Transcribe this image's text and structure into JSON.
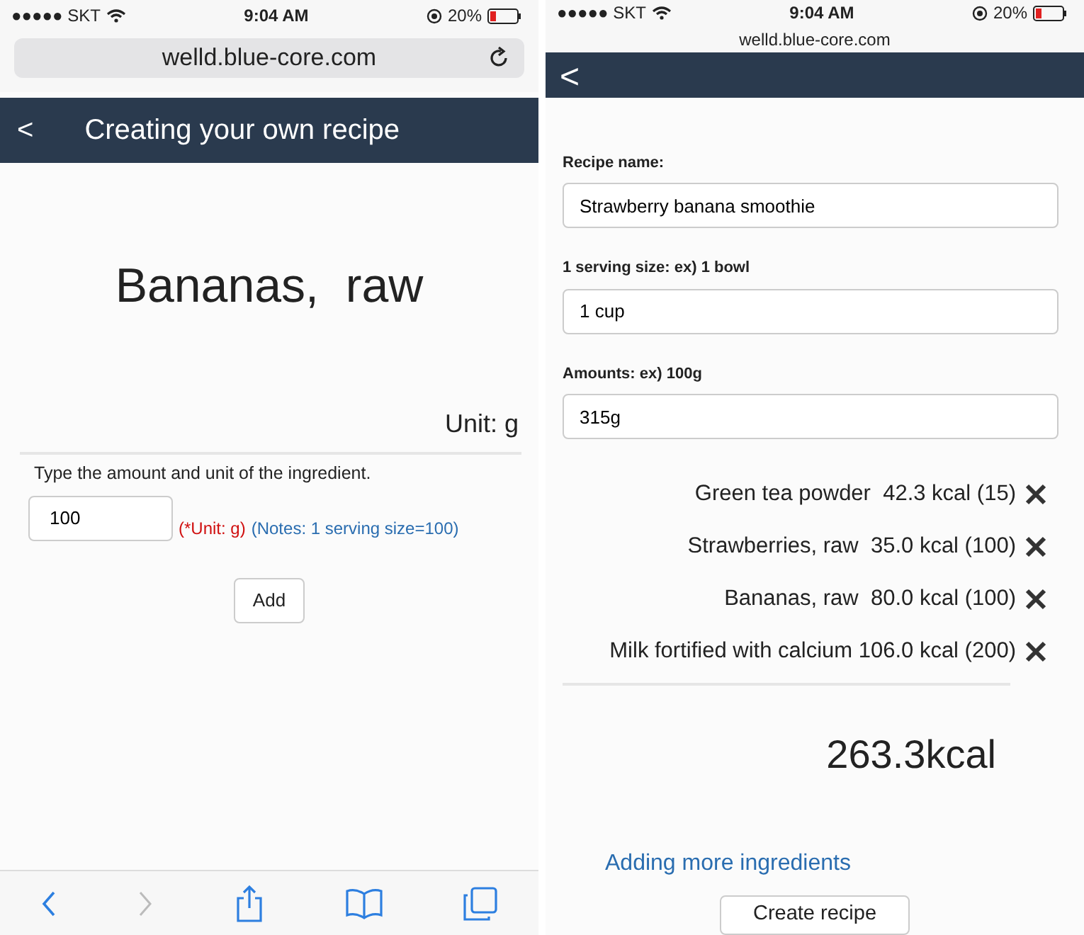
{
  "screens": [
    {
      "status_bar": {
        "carrier": "●●●●● SKT",
        "time": "9:04 AM",
        "battery": "20%"
      },
      "url_bar": {
        "url": "welld.blue-core.com",
        "kind": "full"
      },
      "header": {
        "back": "<",
        "title": "Creating your own recipe"
      },
      "food_title": "Bananas,  raw",
      "unit": "Unit: g",
      "instruction": "Type the amount and unit of the ingredient.",
      "amount_field": {
        "value": "100"
      },
      "unit_note": "(*Unit: g)",
      "serving_note": "(Notes: 1 serving size=100)",
      "add_button": "Add",
      "toolbar": [
        {
          "kind": "back",
          "disabled": false
        },
        {
          "kind": "forward",
          "disabled": true
        },
        {
          "kind": "share",
          "disabled": false
        },
        {
          "kind": "bookmarks",
          "disabled": false
        },
        {
          "kind": "tabs",
          "disabled": false
        }
      ]
    },
    {
      "status_bar": {
        "carrier": "●●●●● SKT",
        "time": "9:04 AM",
        "battery": "20%"
      },
      "url_bar": {
        "url": "welld.blue-core.com",
        "kind": "compact"
      },
      "header": {
        "back": "<"
      },
      "fields": [
        {
          "label": "Recipe name:",
          "value": "Strawberry banana smoothie"
        },
        {
          "label": "1 serving size: ex) 1 bowl",
          "value": "1 cup"
        },
        {
          "label": "Amounts: ex) 100g",
          "value": "315g"
        }
      ],
      "ingredients": [
        {
          "text": "Green tea powder  42.3 kcal (15)"
        },
        {
          "text": "Strawberries, raw  35.0 kcal (100)"
        },
        {
          "text": "Bananas, raw  80.0 kcal (100)"
        },
        {
          "text": "Milk fortified with calcium 106.0 kcal (200)"
        }
      ],
      "total": "263.3kcal",
      "more_link": "Adding more ingredients",
      "create_button": "Create recipe"
    }
  ]
}
